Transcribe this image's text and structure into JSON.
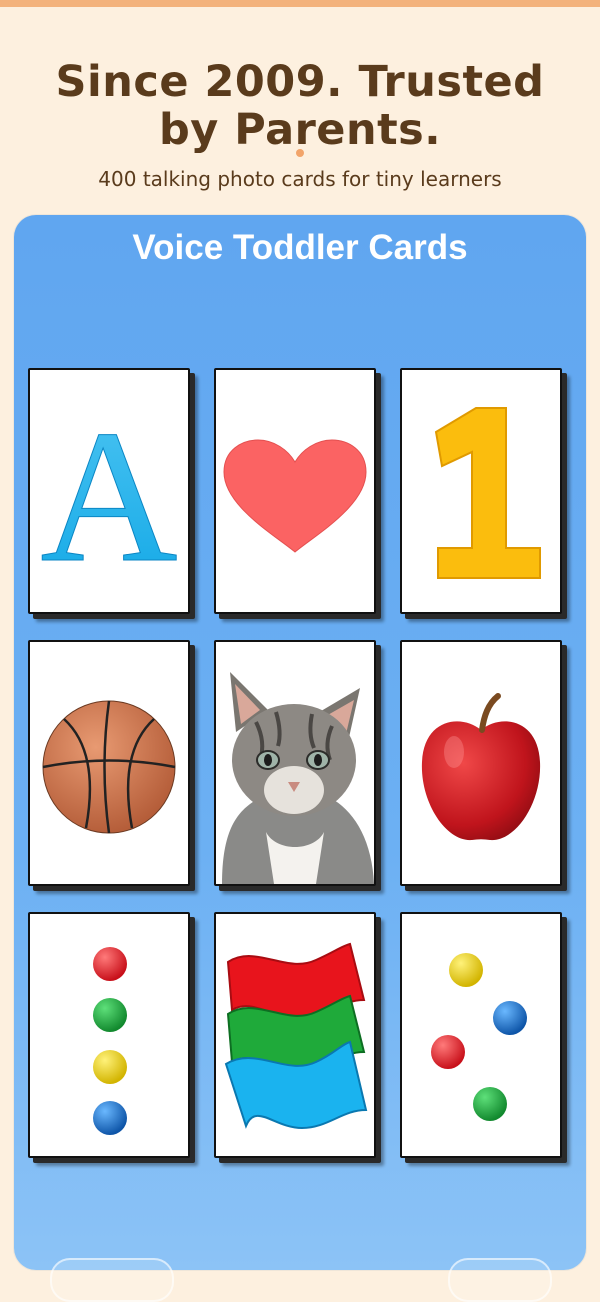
{
  "promo": {
    "headline": "Since 2009. Trusted by Parents.",
    "subtitle": "400 talking photo cards for tiny learners"
  },
  "app": {
    "title": "Voice Toddler Cards"
  },
  "cards": [
    {
      "name": "letter-a-card",
      "icon": "letter-a-icon",
      "symbol": "A"
    },
    {
      "name": "heart-card",
      "icon": "heart-icon"
    },
    {
      "name": "number-one-card",
      "icon": "number-one-icon",
      "symbol": "1"
    },
    {
      "name": "basketball-card",
      "icon": "basketball-icon"
    },
    {
      "name": "kitten-card",
      "icon": "kitten-icon"
    },
    {
      "name": "apple-card",
      "icon": "apple-icon"
    },
    {
      "name": "four-balls-card",
      "icon": "four-colored-balls-icon"
    },
    {
      "name": "flags-card",
      "icon": "wavy-colored-flags-icon"
    },
    {
      "name": "scattered-balls-card",
      "icon": "scattered-colored-balls-icon"
    }
  ],
  "colors": {
    "background": "#fdf0df",
    "accent": "#f3b27c",
    "headline": "#5a3b1c",
    "screen": "#60a6f0"
  }
}
